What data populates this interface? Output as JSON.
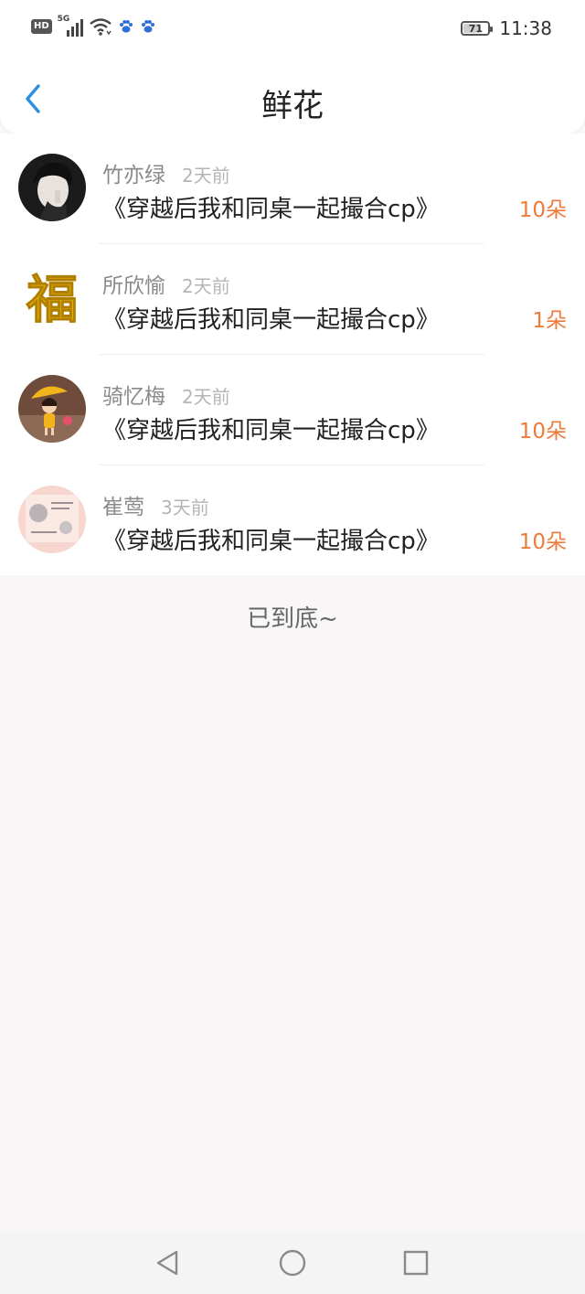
{
  "status_bar": {
    "network_badge": "HD",
    "signal_label": "5G",
    "battery_level": 71,
    "battery_text": "71",
    "time": "11:38",
    "icons": [
      "hd-icon",
      "signal-icon",
      "wifi-icon",
      "paw-icon",
      "paw-icon"
    ]
  },
  "header": {
    "title": "鲜花",
    "back_icon": "chevron-left-icon"
  },
  "flowers": [
    {
      "user": "竹亦绿",
      "time": "2天前",
      "book": "《穿越后我和同桌一起撮合cp》",
      "count": "10朵"
    },
    {
      "user": "所欣愉",
      "time": "2天前",
      "book": "《穿越后我和同桌一起撮合cp》",
      "count": "1朵"
    },
    {
      "user": "骑忆梅",
      "time": "2天前",
      "book": "《穿越后我和同桌一起撮合cp》",
      "count": "10朵"
    },
    {
      "user": "崔莺",
      "time": "3天前",
      "book": "《穿越后我和同桌一起撮合cp》",
      "count": "10朵"
    }
  ],
  "footer": {
    "end_text": "已到底~"
  },
  "avatar_text": {
    "fu": "福"
  },
  "colors": {
    "accent_blue": "#2a8fe0",
    "count_orange": "#ee7a3a",
    "page_background": "#f8f6f7"
  },
  "system_nav": [
    "back-triangle-icon",
    "home-circle-icon",
    "recents-square-icon"
  ]
}
